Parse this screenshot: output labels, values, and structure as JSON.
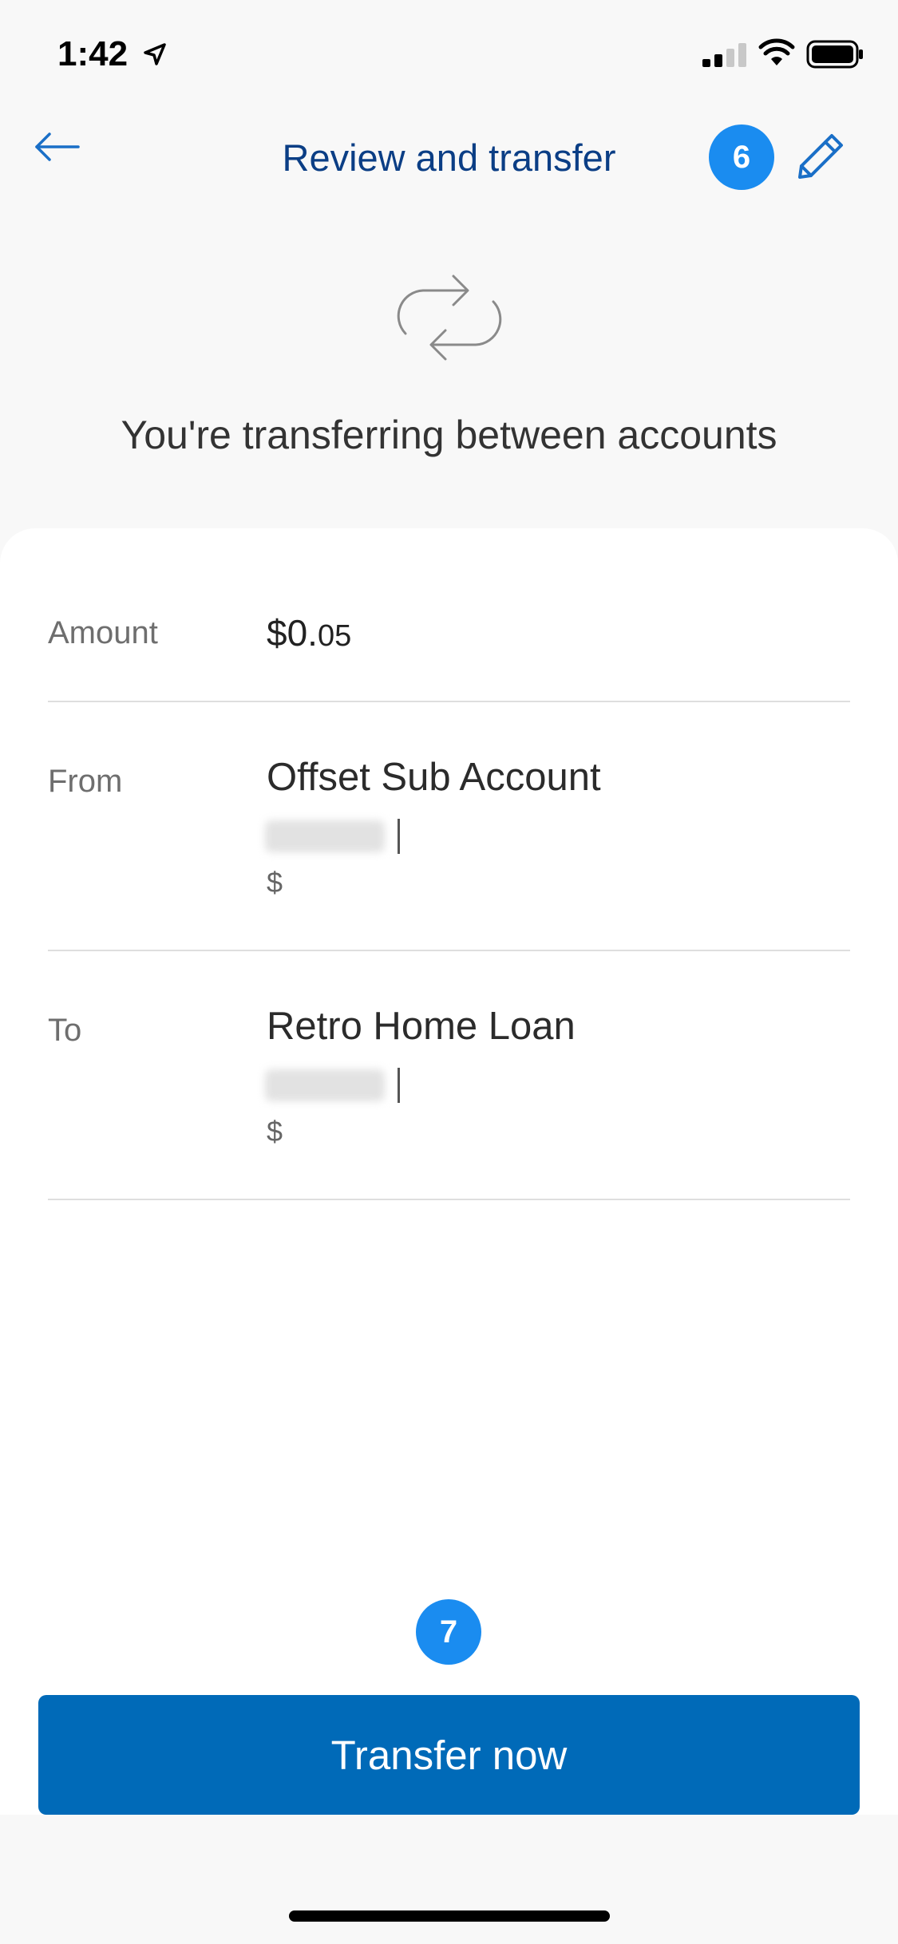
{
  "status_bar": {
    "time": "1:42"
  },
  "header": {
    "title": "Review and transfer",
    "step_badge": "6"
  },
  "summary": {
    "subtitle": "You're transferring between accounts"
  },
  "details": {
    "amount": {
      "label": "Amount",
      "dollars": "$0.",
      "cents": "05"
    },
    "from": {
      "label": "From",
      "account_name": "Offset Sub Account",
      "currency": "$"
    },
    "to": {
      "label": "To",
      "account_name": "Retro Home Loan",
      "currency": "$"
    }
  },
  "footer": {
    "step_badge": "7",
    "transfer_label": "Transfer now"
  },
  "colors": {
    "title": "#0b3e85",
    "badge": "#1a8cf0",
    "button": "#006ab8"
  },
  "icons": {
    "back": "arrow-left-icon",
    "edit": "pencil-icon",
    "transfer": "transfer-arrows-icon"
  }
}
